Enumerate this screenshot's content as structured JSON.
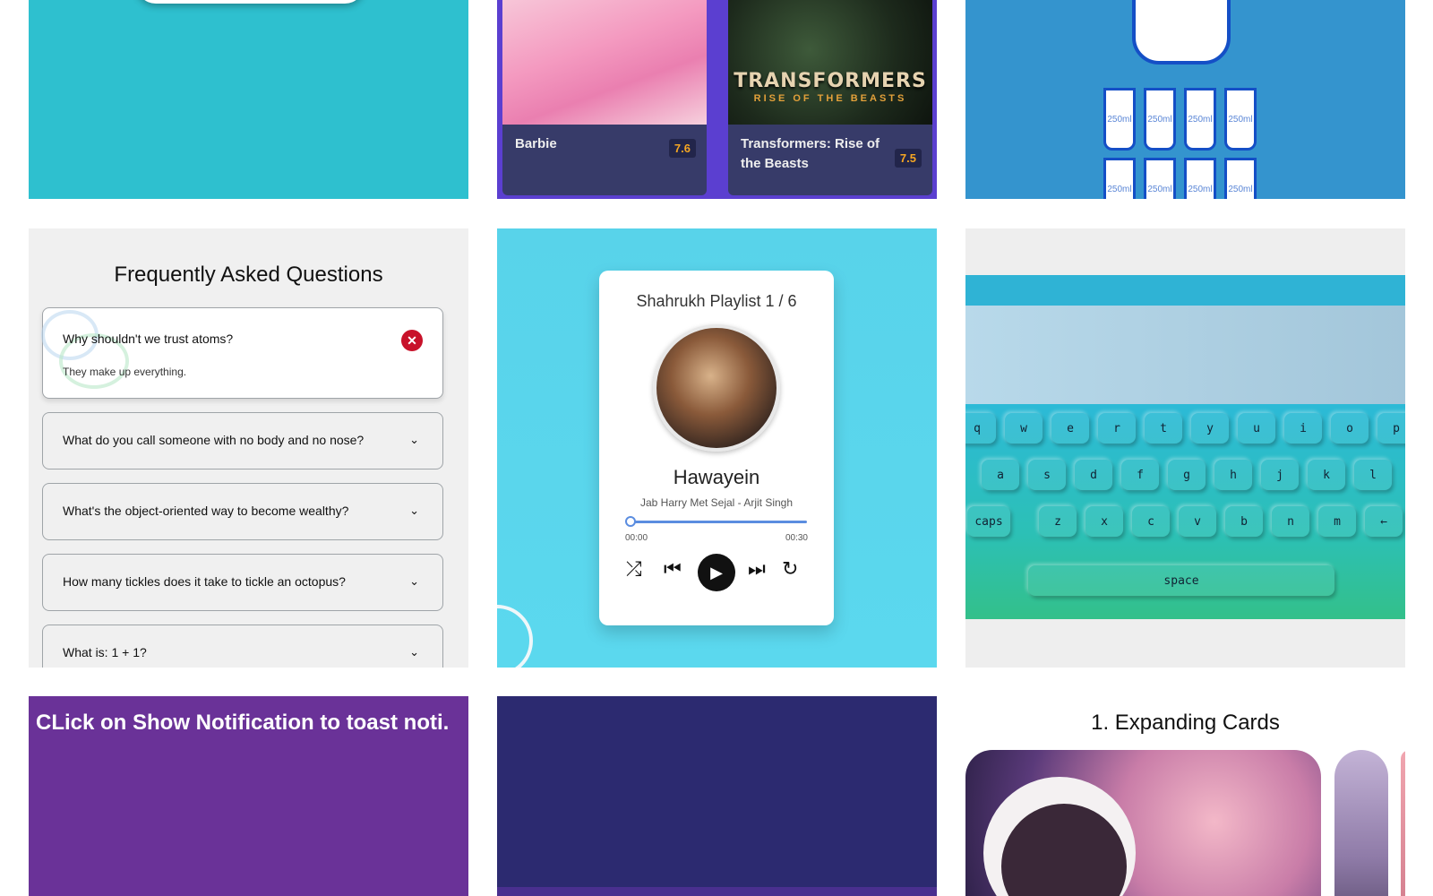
{
  "movies": [
    {
      "title": "Barbie",
      "rating": "7.6"
    },
    {
      "title": "Transformers: Rise of the Beasts",
      "rating": "7.5",
      "poster_title": "TRANSFORMERS",
      "poster_subtitle": "RISE OF THE BEASTS"
    }
  ],
  "water": {
    "cup_label": "250ml"
  },
  "faq": {
    "heading": "Frequently Asked Questions",
    "items": [
      {
        "question": "Why shouldn't we trust atoms?",
        "answer": "They make up everything.",
        "open": true
      },
      {
        "question": "What do you call someone with no body and no nose?",
        "open": false
      },
      {
        "question": "What's the object-oriented way to become wealthy?",
        "open": false
      },
      {
        "question": "How many tickles does it take to tickle an octopus?",
        "open": false
      },
      {
        "question": "What is: 1 + 1?",
        "open": false
      }
    ]
  },
  "player": {
    "playlist": "Shahrukh Playlist 1 / 6",
    "song": "Hawayein",
    "artist": "Jab Harry Met Sejal - Arjit Singh",
    "current_time": "00:00",
    "duration": "00:30",
    "progress": 0
  },
  "keyboard": {
    "rows": [
      [
        "q",
        "w",
        "e",
        "r",
        "t",
        "y",
        "u",
        "i",
        "o",
        "p"
      ],
      [
        "a",
        "s",
        "d",
        "f",
        "g",
        "h",
        "j",
        "k",
        "l"
      ],
      [
        "caps",
        "z",
        "x",
        "c",
        "v",
        "b",
        "n",
        "m",
        "←"
      ]
    ],
    "space_label": "space"
  },
  "toast": {
    "message": "CLick on Show Notification to toast noti."
  },
  "cards": {
    "heading": "1. Expanding Cards"
  },
  "colors": {
    "teal": "#2ec0cf",
    "movie_bg": "#373b69",
    "rating": "#f5a623",
    "water_bg": "#3494ce",
    "cup_border": "#144fc6",
    "faq_close": "#c8122a",
    "music_bg": "#58d3ea",
    "toast_bg": "#6a3298",
    "navy": "#2c2a70"
  }
}
